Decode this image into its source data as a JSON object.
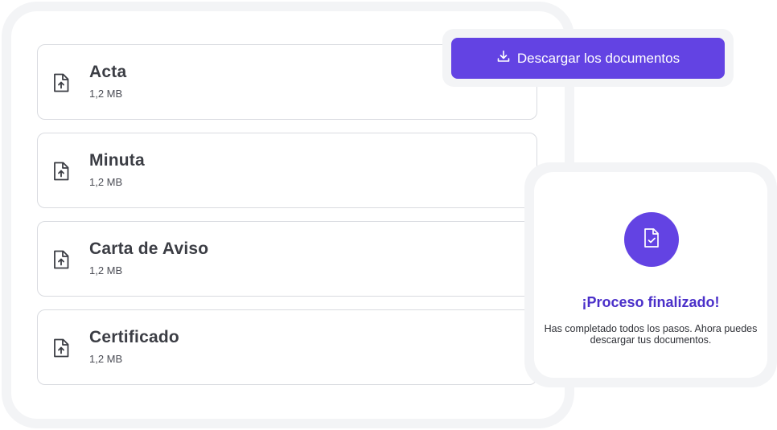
{
  "documents": [
    {
      "title": "Acta",
      "size": "1,2 MB",
      "icon": "file-upload-icon"
    },
    {
      "title": "Minuta",
      "size": "1,2 MB",
      "icon": "file-upload-icon"
    },
    {
      "title": "Carta de Aviso",
      "size": "1,2 MB",
      "icon": "file-upload-icon"
    },
    {
      "title": "Certificado",
      "size": "1,2 MB",
      "icon": "file-upload-icon"
    }
  ],
  "download": {
    "label": "Descargar los documentos",
    "icon": "download-icon"
  },
  "completion": {
    "icon": "file-check-icon",
    "title": "¡Proceso finalizado!",
    "message": "Has completado todos los pasos. Ahora puedes descargar tus documentos."
  },
  "colors": {
    "accent": "#6343e3",
    "title_purple": "#4a2fc9",
    "card_border": "#d9dbe0",
    "ring_gray": "#f3f4f6"
  }
}
